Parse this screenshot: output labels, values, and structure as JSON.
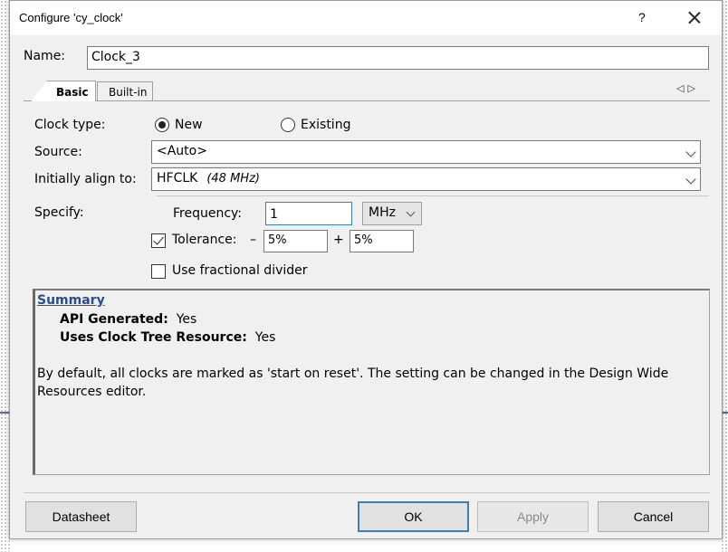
{
  "window": {
    "title": "Configure 'cy_clock'",
    "help_label": "?"
  },
  "name": {
    "label": "Name:",
    "value": "Clock_3"
  },
  "tabs": [
    {
      "label": "Basic",
      "active": true
    },
    {
      "label": "Built-in",
      "active": false
    }
  ],
  "clock_type": {
    "label": "Clock type:",
    "options": [
      {
        "label": "New",
        "selected": true
      },
      {
        "label": "Existing",
        "selected": false
      }
    ]
  },
  "source": {
    "label": "Source:",
    "value": "<Auto>"
  },
  "align": {
    "label": "Initially align to:",
    "value": "HFCLK",
    "detail": "(48 MHz)"
  },
  "specify": {
    "label": "Specify:",
    "frequency_label": "Frequency:",
    "frequency_value": "1",
    "unit": "MHz",
    "tolerance_label": "Tolerance:",
    "tolerance_checked": true,
    "minus_sign": "–",
    "tolerance_minus": "5%",
    "plus_sign": "+",
    "tolerance_plus": "5%",
    "fractional_label": "Use fractional divider",
    "fractional_checked": false
  },
  "summary": {
    "title": "Summary",
    "rows": [
      {
        "key": "API Generated:",
        "value": "Yes"
      },
      {
        "key": "Uses Clock Tree Resource:",
        "value": "Yes"
      }
    ],
    "description": "By default, all clocks are marked as 'start on reset'. The setting can be changed in the Design Wide Resources editor."
  },
  "buttons": {
    "datasheet": "Datasheet",
    "ok": "OK",
    "apply": "Apply",
    "cancel": "Cancel"
  },
  "colors": {
    "accent": "#3c7fb1",
    "summary_link": "#2a4d8f",
    "dialog_bg": "#f0f0f0"
  },
  "icons": {
    "close": "close-icon",
    "tab_scroll": "tab-scroll-arrows-icon"
  }
}
